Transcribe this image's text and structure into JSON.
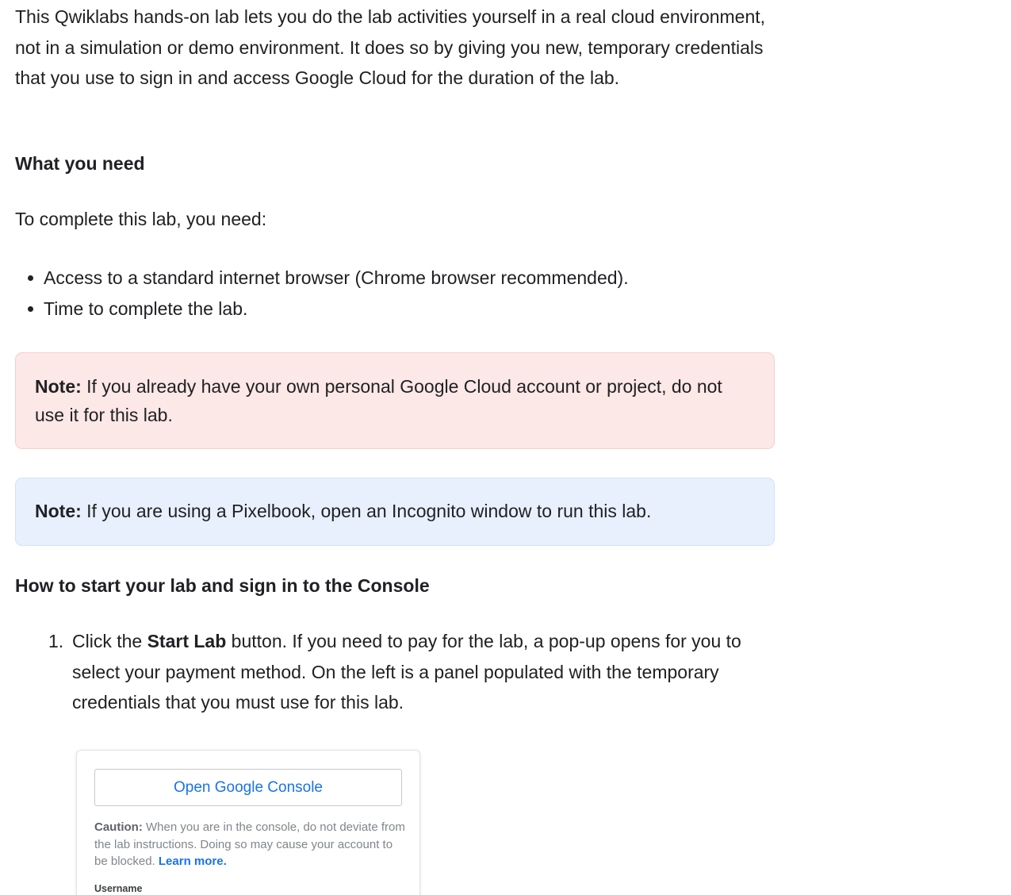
{
  "intro": "This Qwiklabs hands-on lab lets you do the lab activities yourself in a real cloud environment, not in a simulation or demo environment. It does so by giving you new, temporary credentials that you use to sign in and access Google Cloud for the duration of the lab.",
  "what_you_need": {
    "heading": "What you need",
    "text": "To complete this lab, you need:",
    "items": [
      "Access to a standard internet browser (Chrome browser recommended).",
      "Time to complete the lab."
    ]
  },
  "note_red": {
    "label": "Note:",
    "text": " If you already have your own personal Google Cloud account or project, do not use it for this lab."
  },
  "note_blue": {
    "label": "Note:",
    "text": " If you are using a Pixelbook, open an Incognito window to run this lab."
  },
  "start": {
    "heading": "How to start your lab and sign in to the Console",
    "step1_number": "1.",
    "step1_pre": "Click the ",
    "step1_bold": "Start Lab",
    "step1_post": " button. If you need to pay for the lab, a pop-up opens for you to select your payment method. On the left is a panel populated with the temporary credentials that you must use for this lab."
  },
  "panel": {
    "button_label": "Open Google Console",
    "caution_label": "Caution:",
    "caution_text": " When you are in the console, do not deviate from the lab instructions. Doing so may cause your account to be blocked. ",
    "learn_more": "Learn more.",
    "username_label": "Username"
  },
  "colors": {
    "text": "#202124",
    "link": "#1a73e8",
    "note_red_bg": "#fce8e6",
    "note_blue_bg": "#e8f0fe"
  }
}
